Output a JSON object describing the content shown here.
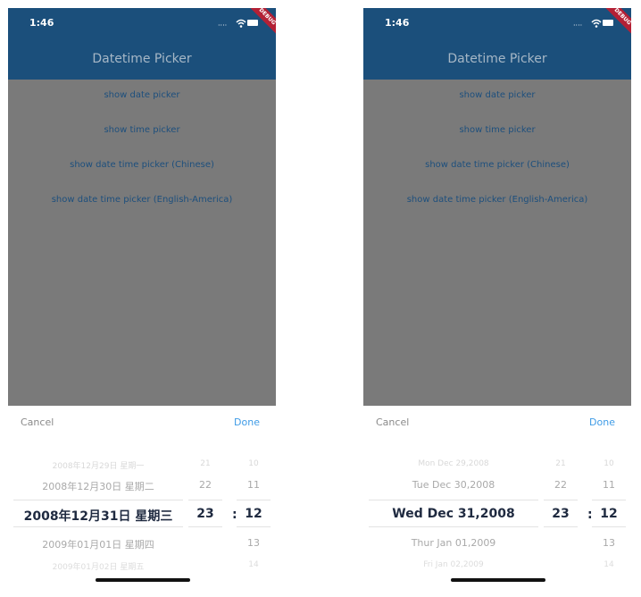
{
  "screens": [
    {
      "status_time": "1:46",
      "banner": "DEBUG",
      "app_title": "Datetime Picker",
      "buttons": [
        "show date picker",
        "show time picker",
        "show date time picker (Chinese)",
        "show date time picker (English-America)"
      ],
      "cancel_label": "Cancel",
      "done_label": "Done",
      "date_column": [
        "2008年12月29日 星期一",
        "2008年12月30日 星期二",
        "2008年12月31日 星期三",
        "2009年01月01日 星期四",
        "2009年01月02日 星期五"
      ],
      "hour_column": [
        "21",
        "22",
        "23",
        "",
        ""
      ],
      "minute_column": [
        "10",
        "11",
        "12",
        "13",
        "14"
      ],
      "separator": ":"
    },
    {
      "status_time": "1:46",
      "banner": "DEBUG",
      "app_title": "Datetime Picker",
      "buttons": [
        "show date picker",
        "show time picker",
        "show date time picker (Chinese)",
        "show date time picker (English-America)"
      ],
      "cancel_label": "Cancel",
      "done_label": "Done",
      "date_column": [
        "Mon Dec 29,2008",
        "Tue Dec 30,2008",
        "Wed Dec 31,2008",
        "Thur Jan 01,2009",
        "Fri Jan 02,2009"
      ],
      "hour_column": [
        "21",
        "22",
        "23",
        "",
        ""
      ],
      "minute_column": [
        "10",
        "11",
        "12",
        "13",
        "14"
      ],
      "separator": ":"
    }
  ],
  "colors": {
    "app_bar": "#1b4f7b",
    "overlay": "#7a7a7a",
    "button_text": "#1d4f7d",
    "done": "#3e9be6",
    "banner": "#b32035"
  },
  "icons": [
    "wifi-icon",
    "battery-icon",
    "signal-dots-icon"
  ]
}
